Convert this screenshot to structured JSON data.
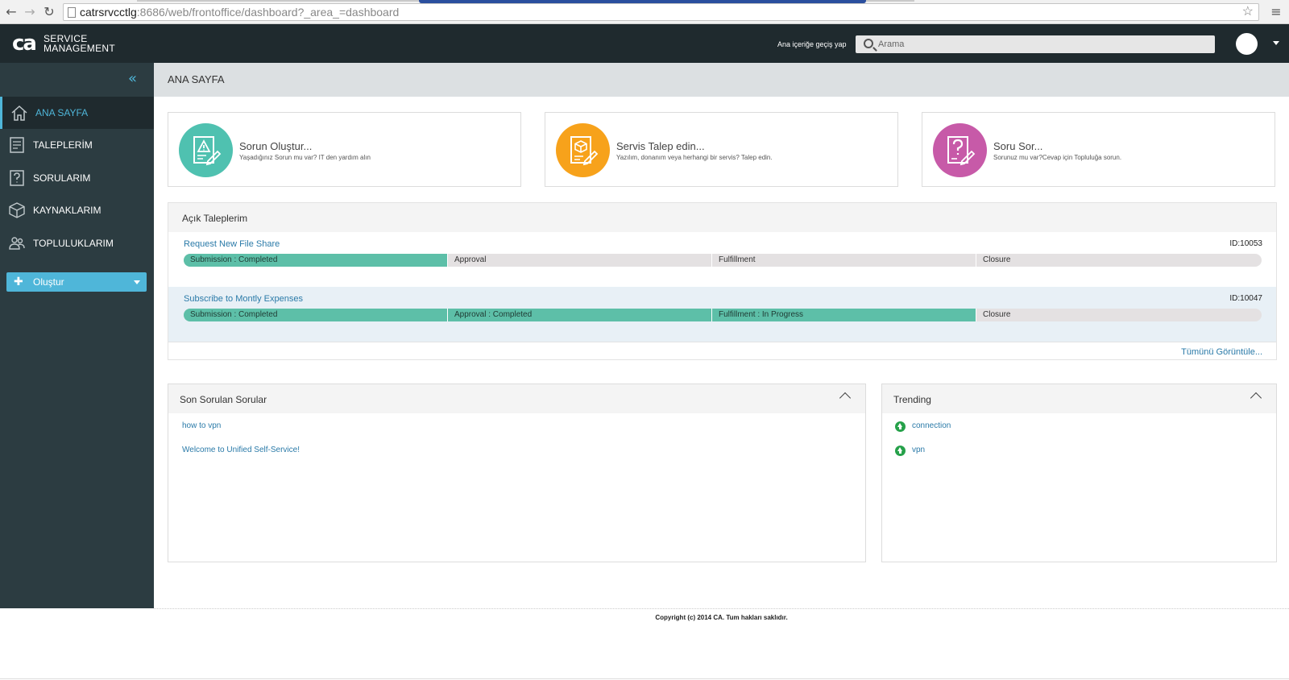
{
  "browser": {
    "url_host": "catrsrvcctlg",
    "url_rest": ":8686/web/frontoffice/dashboard?_area_=dashboard",
    "back_glyph": "←",
    "forward_glyph": "→",
    "reload_glyph": "↻",
    "star_glyph": "☆",
    "menu_glyph": "≡"
  },
  "header": {
    "logo_mark": "ca",
    "logo_line1": "SERVICE",
    "logo_line2": "MANAGEMENT",
    "skip_link": "Ana içeriğe geçiş yap",
    "search_placeholder": "Arama"
  },
  "sidebar": {
    "collapse_glyph": "«",
    "items": [
      {
        "label": "ANA SAYFA",
        "icon": "home-icon",
        "active": true
      },
      {
        "label": "TALEPLERİM",
        "icon": "requests-icon",
        "active": false
      },
      {
        "label": "SORULARIM",
        "icon": "questions-icon",
        "active": false
      },
      {
        "label": "KAYNAKLARIM",
        "icon": "resources-icon",
        "active": false
      },
      {
        "label": "TOPLULUKLARIM",
        "icon": "communities-icon",
        "active": false
      }
    ],
    "create_label": "Oluştur",
    "create_plus": "✚"
  },
  "main": {
    "page_title": "ANA SAYFA",
    "cards": [
      {
        "title": "Sorun Oluştur...",
        "desc": "Yaşadığınız Sorun mu var? IT den yardım alın",
        "color": "#4fc1b0",
        "icon": "incident-icon"
      },
      {
        "title": "Servis Talep edin...",
        "desc": "Yazılım, donanım veya herhangi bir servis? Talep edin.",
        "color": "#f7a21b",
        "icon": "service-request-icon"
      },
      {
        "title": "Soru Sor...",
        "desc": "Sorunuz mu var?Cevap için Topluluğa sorun.",
        "color": "#c75aa8",
        "icon": "question-icon"
      }
    ],
    "open_requests": {
      "title": "Açık Taleplerim",
      "view_all": "Tümünü Görüntüle...",
      "rows": [
        {
          "name": "Request New File Share",
          "id": "ID:10053",
          "stages": [
            {
              "label": "Submission : Completed",
              "done": true
            },
            {
              "label": "Approval",
              "done": false
            },
            {
              "label": "Fulfillment",
              "done": false
            },
            {
              "label": "Closure",
              "done": false
            }
          ]
        },
        {
          "name": "Subscribe to Montly Expenses",
          "id": "ID:10047",
          "stages": [
            {
              "label": "Submission : Completed",
              "done": true
            },
            {
              "label": "Approval : Completed",
              "done": true
            },
            {
              "label": "Fulfillment : In Progress",
              "done": true
            },
            {
              "label": "Closure",
              "done": false
            }
          ]
        }
      ]
    },
    "recent_questions": {
      "title": "Son Sorulan Sorular",
      "items": [
        "how to vpn",
        "Welcome to Unified Self-Service!"
      ]
    },
    "trending": {
      "title": "Trending",
      "items": [
        "connection",
        "vpn"
      ]
    }
  },
  "footer": {
    "copyright": "Copyright (c) 2014 CA. Tum hakları saklıdır."
  },
  "colors": {
    "header_bg": "#1f2a2e",
    "sidebar_bg": "#2c3c41",
    "accent": "#4fb6d9",
    "progress_done": "#5dbfa8",
    "link": "#2a7aa8"
  }
}
